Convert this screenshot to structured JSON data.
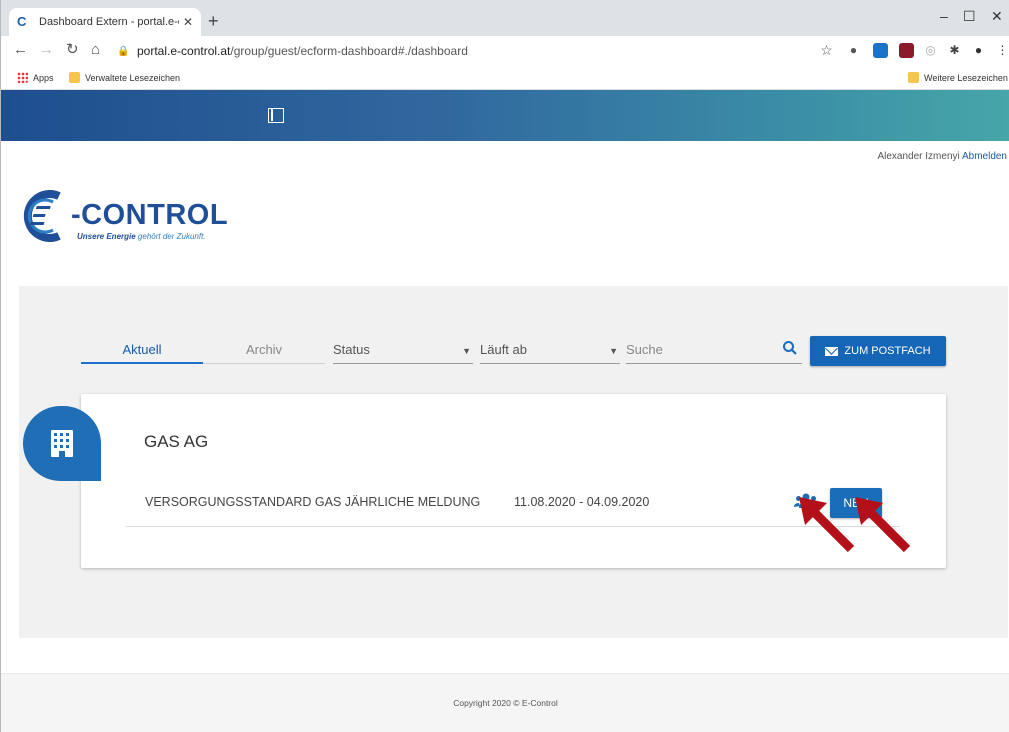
{
  "browser": {
    "tab_title": "Dashboard Extern - portal.e-cont",
    "url_host": "portal.e-control.at",
    "url_path": "/group/guest/ecform-dashboard#./dashboard",
    "bookmarks": [
      "Apps",
      "Verwaltete Lesezeichen"
    ],
    "other_bookmarks": "Weitere Lesezeichen"
  },
  "header": {
    "user_name": "Alexander Izmenyi",
    "logout_label": "Abmelden"
  },
  "logo": {
    "word": "-CONTROL",
    "tag_bold": "Unsere Energie",
    "tag_rest": " gehört der Zukunft."
  },
  "filters": {
    "tabs": [
      "Aktuell",
      "Archiv"
    ],
    "status_placeholder": "Status",
    "expires_placeholder": "Läuft ab",
    "search_placeholder": "Suche",
    "postfach_label": "ZUM POSTFACH"
  },
  "card": {
    "title": "GAS AG",
    "rows": [
      {
        "label": "VERSORGUNGSSTANDARD GAS JÄHRLICHE MELDUNG",
        "dates": "11.08.2020 - 04.09.2020",
        "status_button": "NEU"
      }
    ]
  },
  "footer": {
    "copyright": "Copyright 2020 © E-Control"
  },
  "colors": {
    "primary": "#1566b7",
    "arrow": "#b3101a"
  }
}
